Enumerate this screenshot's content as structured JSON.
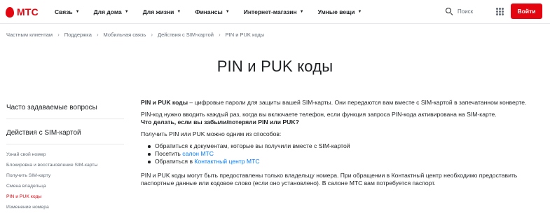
{
  "brand": {
    "name": "МТС",
    "color": "#e30611"
  },
  "header": {
    "nav": [
      "Связь",
      "Для дома",
      "Для жизни",
      "Финансы",
      "Интернет-магазин",
      "Умные вещи"
    ],
    "search_label": "Поиск",
    "login_label": "Войти"
  },
  "breadcrumb": [
    "Частным клиентам",
    "Поддержка",
    "Мобильная связь",
    "Действия с SIM-картой",
    "PIN и PUK коды"
  ],
  "page_title": "PIN и PUK коды",
  "sidebar": {
    "faq_heading": "Часто задаваемые вопросы",
    "section_heading": "Действия с SIM-картой",
    "items": [
      {
        "label": "Узнай свой номер",
        "active": false
      },
      {
        "label": "Блокировка и восстановление SIM-карты",
        "active": false
      },
      {
        "label": "Получить SIM-карту",
        "active": false
      },
      {
        "label": "Смена владельца",
        "active": false
      },
      {
        "label": "PIN и PUK коды",
        "active": true
      },
      {
        "label": "Изменение номера",
        "active": false
      }
    ]
  },
  "content": {
    "intro_bold": "PIN и PUK коды",
    "intro_rest": " – цифровые пароли для защиты вашей SIM-карты. Они передаются вам вместе с SIM-картой в запечатанном конверте.",
    "pin_note": "PIN-код нужно вводить каждый раз, когда вы включаете телефон, если функция запроса PIN-кода активирована на SIM-карте.",
    "question": "Что делать, если вы забыли/потеряли PIN или PUK?",
    "ways_intro": "Получить PIN или PUK можно одним из способов:",
    "ways": {
      "item1": "Обратиться к документам, которые вы получили вместе с SIM-картой",
      "item2_prefix": "Посетить ",
      "item2_link": "салон МТС",
      "item3_prefix": "Обратиться в ",
      "item3_link": "Контактный центр МТС"
    },
    "outro": "PIN и PUK коды могут быть предоставлены только владельцу номера. При обращении в Контактный центр необходимо предоставить паспортные данные или кодовое слово (если оно установлено). В салоне МТС вам потребуется паспорт."
  },
  "colors": {
    "accent": "#e30611",
    "link": "#007cff",
    "muted": "#626c77",
    "text": "#1d2023"
  },
  "icons": [
    "search-icon",
    "apps-grid-icon",
    "chevron-down-icon",
    "chevron-right-icon"
  ]
}
